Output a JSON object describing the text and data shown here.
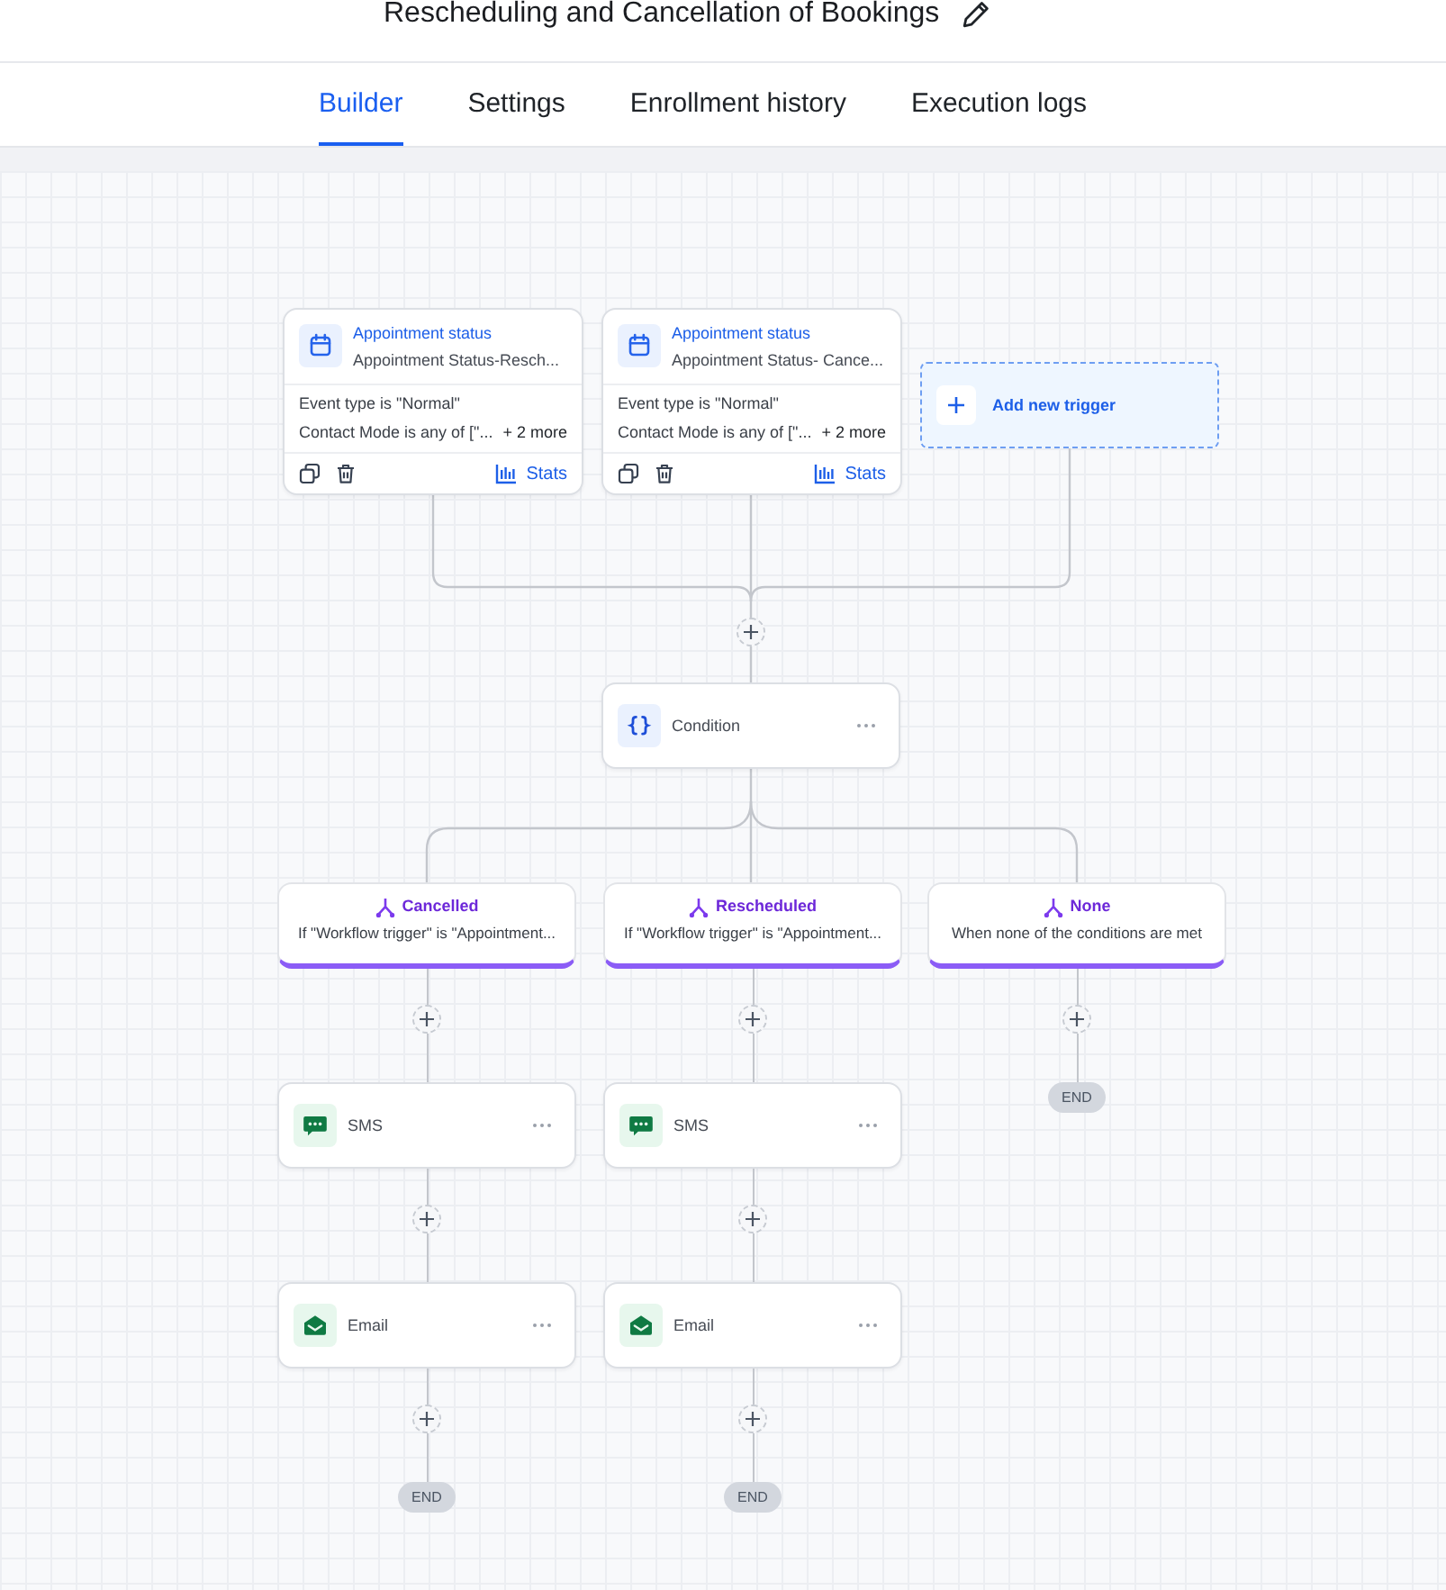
{
  "header": {
    "title": "Rescheduling and Cancellation of Bookings",
    "tabs": [
      {
        "label": "Builder",
        "selected": true
      },
      {
        "label": "Settings",
        "selected": false
      },
      {
        "label": "Enrollment history",
        "selected": false
      },
      {
        "label": "Execution logs",
        "selected": false
      }
    ]
  },
  "canvas": {
    "triggers": [
      {
        "title": "Appointment status",
        "subtitle": "Appointment Status-Resch...",
        "filters": [
          "Event type is \"Normal\"",
          "Contact Mode is any of [\"..."
        ],
        "more": "+ 2 more",
        "stats": "Stats"
      },
      {
        "title": "Appointment status",
        "subtitle": "Appointment Status- Cance...",
        "filters": [
          "Event type is \"Normal\"",
          "Contact Mode is any of [\"..."
        ],
        "more": "+ 2 more",
        "stats": "Stats"
      }
    ],
    "add_trigger": "Add new trigger",
    "condition": {
      "label": "Condition"
    },
    "branches": [
      {
        "name": "Cancelled",
        "description": "If \"Workflow trigger\" is \"Appointment...",
        "steps": [
          {
            "kind": "sms",
            "label": "SMS"
          },
          {
            "kind": "email",
            "label": "Email"
          }
        ],
        "end": "END"
      },
      {
        "name": "Rescheduled",
        "description": "If \"Workflow trigger\" is \"Appointment...",
        "steps": [
          {
            "kind": "sms",
            "label": "SMS"
          },
          {
            "kind": "email",
            "label": "Email"
          }
        ],
        "end": "END"
      },
      {
        "name": "None",
        "description": "When none of the conditions are met",
        "end": "END"
      }
    ]
  }
}
